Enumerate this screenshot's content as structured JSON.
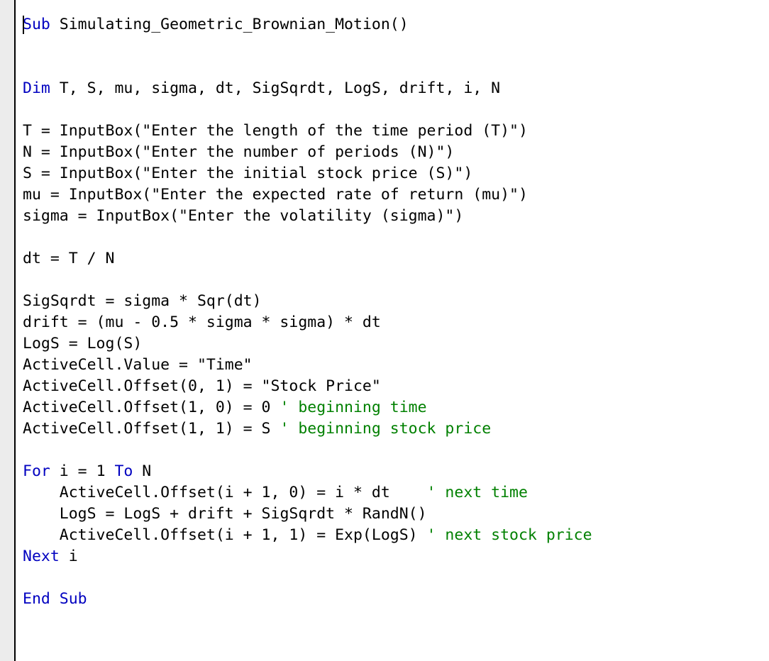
{
  "editor": {
    "name": "vba-code-editor",
    "background_color": "#ffffff",
    "margin_bar_color": "#ececec",
    "margin_border_color": "#000000",
    "caret_visible": true,
    "font_size_px": 21.5,
    "line_height_px": 30,
    "colors": {
      "keyword": "#0000c0",
      "plain": "#000000",
      "comment": "#008000",
      "string": "#000000"
    }
  },
  "code": {
    "language": "VBA",
    "procedure_name": "Simulating_Geometric_Brownian_Motion",
    "lines": [
      {
        "id": 1,
        "indent": 0,
        "tokens": [
          {
            "t": "Sub",
            "k": "kw"
          },
          {
            "t": " Simulating_Geometric_Brownian_Motion()",
            "k": "plain"
          }
        ]
      },
      {
        "id": 2,
        "indent": 0,
        "tokens": []
      },
      {
        "id": 3,
        "indent": 0,
        "tokens": []
      },
      {
        "id": 4,
        "indent": 0,
        "tokens": [
          {
            "t": "Dim",
            "k": "kw"
          },
          {
            "t": " T, S, mu, sigma, dt, SigSqrdt, LogS, drift, i, N",
            "k": "plain"
          }
        ]
      },
      {
        "id": 5,
        "indent": 0,
        "tokens": []
      },
      {
        "id": 6,
        "indent": 0,
        "tokens": [
          {
            "t": "T = InputBox(\"Enter the length of the time period (T)\")",
            "k": "plain"
          }
        ]
      },
      {
        "id": 7,
        "indent": 0,
        "tokens": [
          {
            "t": "N = InputBox(\"Enter the number of periods (N)\")",
            "k": "plain"
          }
        ]
      },
      {
        "id": 8,
        "indent": 0,
        "tokens": [
          {
            "t": "S = InputBox(\"Enter the initial stock price (S)\")",
            "k": "plain"
          }
        ]
      },
      {
        "id": 9,
        "indent": 0,
        "tokens": [
          {
            "t": "mu = InputBox(\"Enter the expected rate of return (mu)\")",
            "k": "plain"
          }
        ]
      },
      {
        "id": 10,
        "indent": 0,
        "tokens": [
          {
            "t": "sigma = InputBox(\"Enter the volatility (sigma)\")",
            "k": "plain"
          }
        ]
      },
      {
        "id": 11,
        "indent": 0,
        "tokens": []
      },
      {
        "id": 12,
        "indent": 0,
        "tokens": [
          {
            "t": "dt = T / N",
            "k": "plain"
          }
        ]
      },
      {
        "id": 13,
        "indent": 0,
        "tokens": []
      },
      {
        "id": 14,
        "indent": 0,
        "tokens": [
          {
            "t": "SigSqrdt = sigma * Sqr(dt)",
            "k": "plain"
          }
        ]
      },
      {
        "id": 15,
        "indent": 0,
        "tokens": [
          {
            "t": "drift = (mu - 0.5 * sigma * sigma) * dt",
            "k": "plain"
          }
        ]
      },
      {
        "id": 16,
        "indent": 0,
        "tokens": [
          {
            "t": "LogS = Log(S)",
            "k": "plain"
          }
        ]
      },
      {
        "id": 17,
        "indent": 0,
        "tokens": [
          {
            "t": "ActiveCell.Value = \"Time\"",
            "k": "plain"
          }
        ]
      },
      {
        "id": 18,
        "indent": 0,
        "tokens": [
          {
            "t": "ActiveCell.Offset(0, 1) = \"Stock Price\"",
            "k": "plain"
          }
        ]
      },
      {
        "id": 19,
        "indent": 0,
        "tokens": [
          {
            "t": "ActiveCell.Offset(1, 0) = 0 ",
            "k": "plain"
          },
          {
            "t": "' beginning time",
            "k": "cmt"
          }
        ]
      },
      {
        "id": 20,
        "indent": 0,
        "tokens": [
          {
            "t": "ActiveCell.Offset(1, 1) = S ",
            "k": "plain"
          },
          {
            "t": "' beginning stock price",
            "k": "cmt"
          }
        ]
      },
      {
        "id": 21,
        "indent": 0,
        "tokens": []
      },
      {
        "id": 22,
        "indent": 0,
        "tokens": [
          {
            "t": "For",
            "k": "kw"
          },
          {
            "t": " i = 1 ",
            "k": "plain"
          },
          {
            "t": "To",
            "k": "kw"
          },
          {
            "t": " N",
            "k": "plain"
          }
        ]
      },
      {
        "id": 23,
        "indent": 4,
        "tokens": [
          {
            "t": "ActiveCell.Offset(i + 1, 0) = i * dt    ",
            "k": "plain"
          },
          {
            "t": "' next time",
            "k": "cmt"
          }
        ]
      },
      {
        "id": 24,
        "indent": 4,
        "tokens": [
          {
            "t": "LogS = LogS + drift + SigSqrdt * RandN()",
            "k": "plain"
          }
        ]
      },
      {
        "id": 25,
        "indent": 4,
        "tokens": [
          {
            "t": "ActiveCell.Offset(i + 1, 1) = Exp(LogS) ",
            "k": "plain"
          },
          {
            "t": "' next stock price",
            "k": "cmt"
          }
        ]
      },
      {
        "id": 26,
        "indent": 0,
        "tokens": [
          {
            "t": "Next",
            "k": "kw"
          },
          {
            "t": " i",
            "k": "plain"
          }
        ]
      },
      {
        "id": 27,
        "indent": 0,
        "tokens": []
      },
      {
        "id": 28,
        "indent": 0,
        "tokens": [
          {
            "t": "End Sub",
            "k": "kw"
          }
        ]
      }
    ]
  }
}
